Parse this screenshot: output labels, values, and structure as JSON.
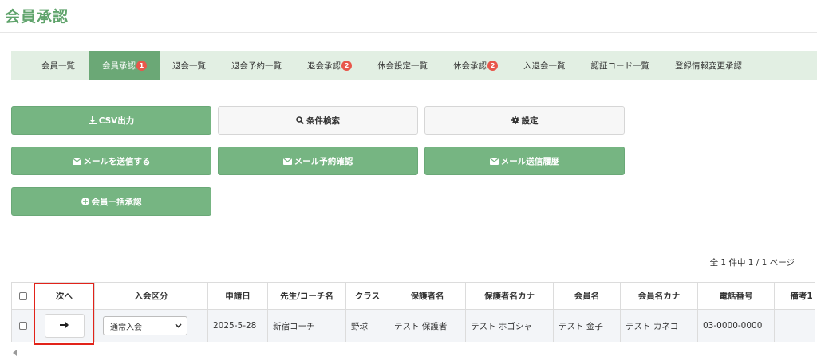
{
  "page": {
    "title": "会員承認"
  },
  "tabs": [
    {
      "label": "会員一覧",
      "badge": ""
    },
    {
      "label": "会員承認",
      "badge": "1",
      "active": true
    },
    {
      "label": "退会一覧",
      "badge": ""
    },
    {
      "label": "退会予約一覧",
      "badge": ""
    },
    {
      "label": "退会承認",
      "badge": "2"
    },
    {
      "label": "休会設定一覧",
      "badge": ""
    },
    {
      "label": "休会承認",
      "badge": "2"
    },
    {
      "label": "入退会一覧",
      "badge": ""
    },
    {
      "label": "認証コード一覧",
      "badge": ""
    },
    {
      "label": "登録情報変更承認",
      "badge": ""
    }
  ],
  "actions": {
    "csv_label": "CSV出力",
    "search_label": "条件検索",
    "settings_label": "設定",
    "send_mail_label": "メールを送信する",
    "mail_reserve_label": "メール予約確認",
    "mail_history_label": "メール送信履歴",
    "bulk_approve_label": "会員一括承認"
  },
  "pager": {
    "text": "全 1 件中 1 / 1 ページ"
  },
  "table": {
    "headers": {
      "next": "次へ",
      "join_type": "入会区分",
      "apply_date": "申請日",
      "coach": "先生/コーチ名",
      "class": "クラス",
      "guardian": "保護者名",
      "guardian_kana": "保護者名カナ",
      "member": "会員名",
      "member_kana": "会員名カナ",
      "phone": "電話番号",
      "note": "備考1"
    },
    "row": {
      "join_type": "通常入会",
      "apply_date": "2025-5-28",
      "coach": "新宿コーチ",
      "class": "野球",
      "guardian": "テスト 保護者",
      "guardian_kana": "テスト ホゴシャ",
      "member": "テスト 金子",
      "member_kana": "テスト カネコ",
      "phone": "03-0000-0000",
      "note": ""
    }
  },
  "colors": {
    "accent": "#6ba876",
    "button_green": "#76b582",
    "tab_bg": "#e2efe3",
    "badge": "#e8574b",
    "highlight": "#e2231a"
  },
  "icons": {
    "csv": "download-icon",
    "search": "search-icon",
    "settings": "gear-icon",
    "mail": "envelope-icon",
    "bulk": "plus-circle-icon",
    "next": "arrow-right-icon",
    "select": "chevron-down-icon"
  }
}
